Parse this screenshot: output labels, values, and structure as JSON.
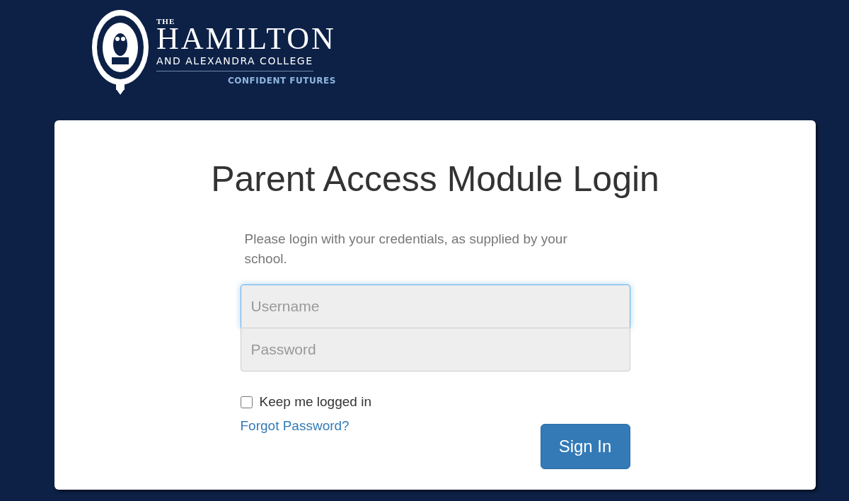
{
  "logo": {
    "prefix": "THE",
    "name": "HAMILTON",
    "subtitle": "AND ALEXANDRA COLLEGE",
    "tagline": "CONFIDENT FUTURES"
  },
  "login": {
    "title": "Parent Access Module Login",
    "intro": "Please login with your credentials, as supplied by your school.",
    "fields": [
      {
        "placeholder": "Username",
        "focused": true
      },
      {
        "placeholder": "Password",
        "focused": false
      }
    ],
    "remember": {
      "label": "Keep me logged in",
      "checked": false
    },
    "forgot_link": "Forgot Password?",
    "submit": "Sign In"
  }
}
